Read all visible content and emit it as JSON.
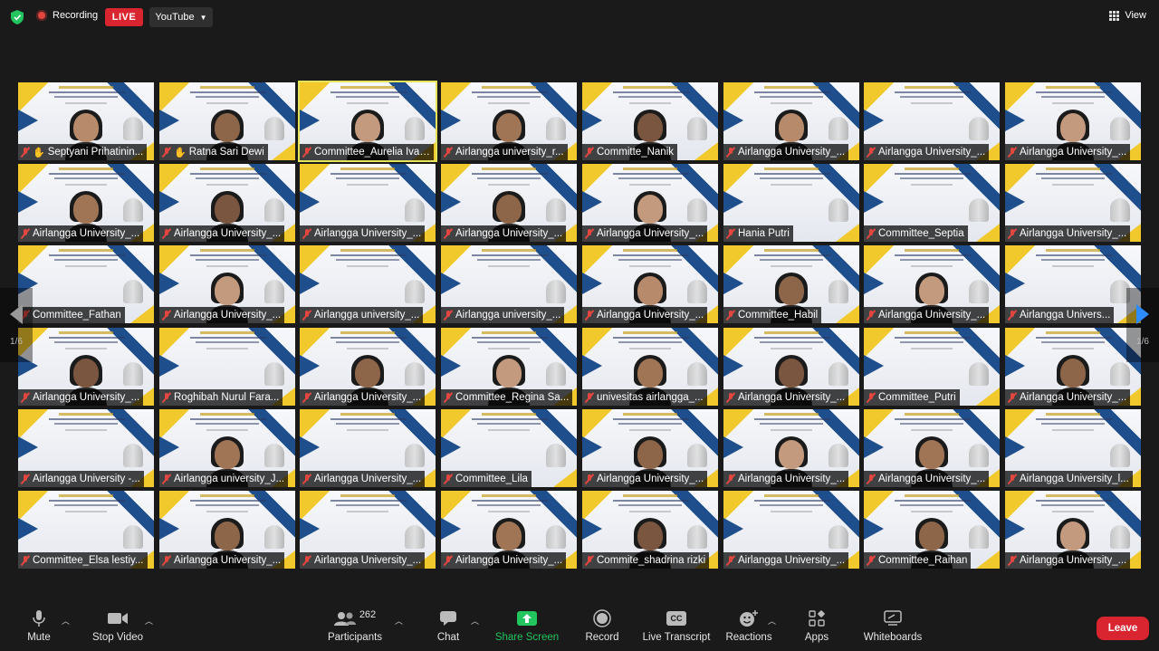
{
  "topbar": {
    "recording_label": "Recording",
    "live_label": "LIVE",
    "stream_platform": "YouTube",
    "view_label": "View"
  },
  "gallery": {
    "page_indicator": "1/6",
    "tiles": [
      {
        "name": "Septyani Prihatinin...",
        "raised_hand": true,
        "person": true
      },
      {
        "name": "Ratna Sari Dewi",
        "raised_hand": true,
        "person": true
      },
      {
        "name": "Committee_Aurelia Ivana",
        "active": true,
        "person": true
      },
      {
        "name": "Airlangga university_r...",
        "person": true
      },
      {
        "name": "Committe_Nanik",
        "person": true
      },
      {
        "name": "Airlangga University_...",
        "person": true
      },
      {
        "name": "Airlangga University_...",
        "person": false
      },
      {
        "name": "Airlangga University_...",
        "person": true
      },
      {
        "name": "Airlangga University_...",
        "person": true
      },
      {
        "name": "Airlangga University_...",
        "person": true
      },
      {
        "name": "Airlangga University_...",
        "person": false
      },
      {
        "name": "Airlangga University_...",
        "person": true
      },
      {
        "name": "Airlangga University_...",
        "person": true
      },
      {
        "name": "Hania Putri",
        "person": false
      },
      {
        "name": "Committee_Septia",
        "person": false
      },
      {
        "name": "Airlangga University_...",
        "person": false
      },
      {
        "name": "Committee_Fathan",
        "person": false
      },
      {
        "name": "Airlangga University_...",
        "person": true
      },
      {
        "name": "Airlangga university_...",
        "person": false
      },
      {
        "name": "Airlangga university_...",
        "person": false
      },
      {
        "name": "Airlangga University_...",
        "person": true
      },
      {
        "name": "Committee_Habil",
        "person": true
      },
      {
        "name": "Airlangga University_...",
        "person": true
      },
      {
        "name": "Airlangga Univers...",
        "person": false
      },
      {
        "name": "Airlangga University_...",
        "person": true
      },
      {
        "name": "Roghibah Nurul Fara...",
        "person": false
      },
      {
        "name": "Airlangga University_...",
        "person": true
      },
      {
        "name": "Committee_Regina Sa...",
        "person": true
      },
      {
        "name": "univesitas airlangga_...",
        "person": true
      },
      {
        "name": "Airlangga University_...",
        "person": true
      },
      {
        "name": "Committee_Putri",
        "person": false
      },
      {
        "name": "Airlangga University_...",
        "person": true
      },
      {
        "name": "Airlangga University -...",
        "person": false
      },
      {
        "name": "Airlangga university_J...",
        "person": true
      },
      {
        "name": "Airlangga University_...",
        "person": false
      },
      {
        "name": "Committee_Lila",
        "person": false
      },
      {
        "name": "Airlangga University_...",
        "person": true
      },
      {
        "name": "Airlangga University_...",
        "person": true
      },
      {
        "name": "Airlangga University_...",
        "person": true
      },
      {
        "name": "Airlangga University_l...",
        "person": false
      },
      {
        "name": "Committee_Elsa lestiy...",
        "person": false
      },
      {
        "name": "Airlangga University_...",
        "person": true
      },
      {
        "name": "Airlangga University_...",
        "person": false
      },
      {
        "name": "Airlangga University_...",
        "person": true
      },
      {
        "name": "Commite_shadrina rizki",
        "person": true
      },
      {
        "name": "Airlangga University_...",
        "person": false
      },
      {
        "name": "Committee_Raihan",
        "person": true
      },
      {
        "name": "Airlangga University_...",
        "person": true
      }
    ]
  },
  "toolbar": {
    "mute": "Mute",
    "stop_video": "Stop Video",
    "participants": "Participants",
    "participants_count": "262",
    "chat": "Chat",
    "share_screen": "Share Screen",
    "record": "Record",
    "live_transcript": "Live Transcript",
    "cc_icon_text": "CC",
    "reactions": "Reactions",
    "apps": "Apps",
    "whiteboards": "Whiteboards",
    "leave": "Leave"
  },
  "colors": {
    "background": "#1a1a1a",
    "live_red": "#d9252f",
    "share_green": "#22c55e",
    "active_speaker": "#e4e35a",
    "pager_arrow_active": "#2d8cff"
  }
}
